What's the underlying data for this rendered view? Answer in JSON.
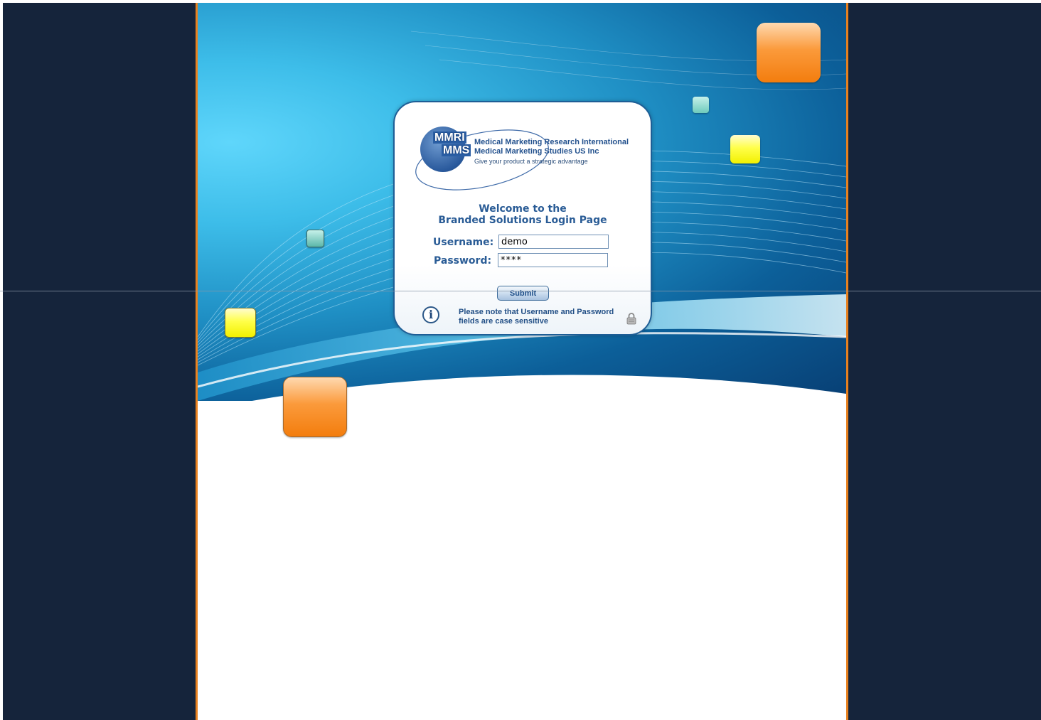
{
  "logo": {
    "abbr_primary": "MMRI",
    "abbr_secondary": "MMS",
    "company_line1": "Medical Marketing Research International",
    "company_line2": "Medical Marketing Studies US Inc",
    "tagline": "Give your product a strategic advantage"
  },
  "welcome": {
    "line1": "Welcome to the",
    "line2": "Branded Solutions Login Page"
  },
  "form": {
    "username_label": "Username:",
    "username_value": "demo",
    "password_label": "Password:",
    "password_value": "****",
    "submit_label": "Submit"
  },
  "note": {
    "text": "Please note that Username and Password fields are case sensitive"
  },
  "icons": {
    "info": "info-icon",
    "lock": "lock-icon"
  },
  "colors": {
    "page_background": "#15243b",
    "frame_accent": "#e8811f",
    "heading_blue": "#2a5c96",
    "card_border": "#1e5e96"
  }
}
